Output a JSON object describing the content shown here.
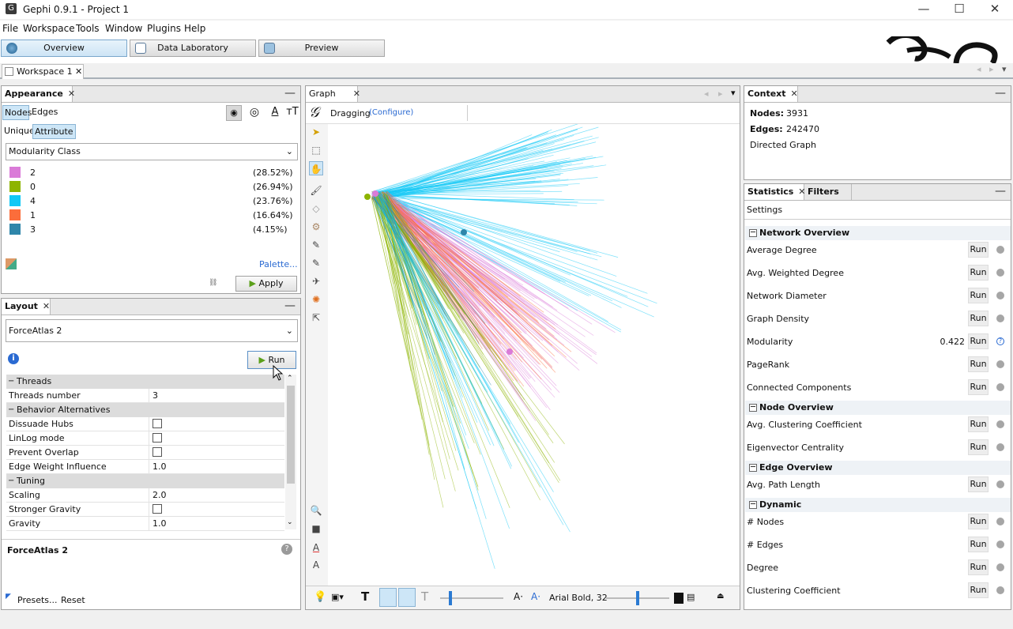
{
  "window": {
    "title": "Gephi 0.9.1 - Project 1"
  },
  "menu": [
    "File",
    "Workspace",
    "Tools",
    "Window",
    "Plugins",
    "Help"
  ],
  "modes": {
    "overview": "Overview",
    "data_lab": "Data Laboratory",
    "preview": "Preview"
  },
  "workspace_tab": "Workspace 1",
  "appearance": {
    "title": "Appearance",
    "tabs": {
      "nodes": "Nodes",
      "edges": "Edges"
    },
    "subtabs": {
      "unique": "Unique",
      "attribute": "Attribute"
    },
    "attribute": "Modularity Class",
    "classes": [
      {
        "label": "2",
        "pct": "(28.52%)",
        "color": "#da7bd8"
      },
      {
        "label": "0",
        "pct": "(26.94%)",
        "color": "#8db400"
      },
      {
        "label": "4",
        "pct": "(23.76%)",
        "color": "#12c8f5"
      },
      {
        "label": "1",
        "pct": "(16.64%)",
        "color": "#fb6d3b"
      },
      {
        "label": "3",
        "pct": "(4.15%)",
        "color": "#2e86aa"
      }
    ],
    "palette": "Palette...",
    "apply": "Apply"
  },
  "layout": {
    "title": "Layout",
    "algorithm": "ForceAtlas 2",
    "run": "Run",
    "sections": {
      "threads": "Threads",
      "behavior": "Behavior Alternatives",
      "tuning": "Tuning"
    },
    "props": {
      "threads_number": {
        "k": "Threads number",
        "v": "3"
      },
      "dissuade": {
        "k": "Dissuade Hubs"
      },
      "linlog": {
        "k": "LinLog mode"
      },
      "overlap": {
        "k": "Prevent Overlap"
      },
      "edge_weight": {
        "k": "Edge Weight Influence",
        "v": "1.0"
      },
      "scaling": {
        "k": "Scaling",
        "v": "2.0"
      },
      "stronger": {
        "k": "Stronger Gravity"
      },
      "gravity": {
        "k": "Gravity",
        "v": "1.0"
      }
    },
    "desc_title": "ForceAtlas 2",
    "presets": "Presets...",
    "reset": "Reset"
  },
  "graph": {
    "tab": "Graph",
    "mode": "Dragging",
    "configure": "(Configure)",
    "font": "Arial Bold, 32"
  },
  "context": {
    "title": "Context",
    "nodes_label": "Nodes:",
    "nodes": "3931",
    "edges_label": "Edges:",
    "edges": "242470",
    "type": "Directed Graph"
  },
  "statistics": {
    "tab": "Statistics",
    "filters": "Filters",
    "settings": "Settings",
    "run": "Run",
    "sections": {
      "network": "Network Overview",
      "node": "Node Overview",
      "edge": "Edge Overview",
      "dynamic": "Dynamic"
    },
    "rows": {
      "avg_degree": "Average Degree",
      "avg_wdegree": "Avg. Weighted Degree",
      "diameter": "Network Diameter",
      "density": "Graph Density",
      "modularity": "Modularity",
      "modularity_val": "0.422",
      "pagerank": "PageRank",
      "components": "Connected Components",
      "clustering": "Avg. Clustering Coefficient",
      "eigen": "Eigenvector Centrality",
      "pathlen": "Avg. Path Length",
      "dyn_nodes": "# Nodes",
      "dyn_edges": "# Edges",
      "dyn_degree": "Degree",
      "dyn_cc": "Clustering Coefficient"
    }
  }
}
